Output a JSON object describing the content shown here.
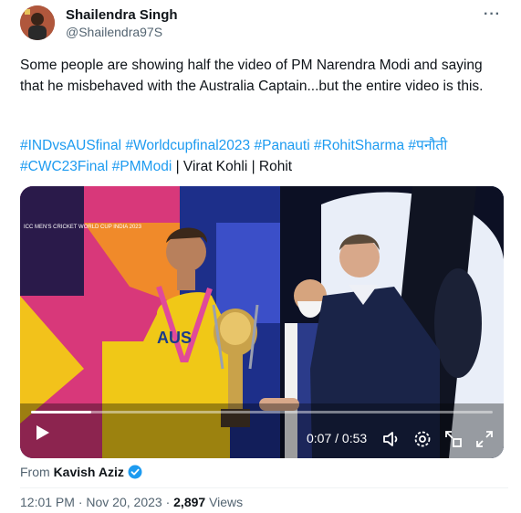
{
  "author": {
    "name": "Shailendra Singh",
    "handle": "@Shailendra97S"
  },
  "post": {
    "text": "Some people are showing half the video of PM Narendra Modi and saying that he misbehaved with the Australia Captain...but the entire video is this.",
    "hashtags": [
      "#INDvsAUSfinal",
      "#Worldcupfinal2023",
      "#Panauti",
      "#RohitSharma",
      "#पनौती",
      "#CWC23Final",
      "#PMModi"
    ],
    "trailing": "| Virat Kohli | Rohit"
  },
  "video": {
    "time_display": "0:07 / 0:53",
    "progress": 0.13,
    "jersey_text": "AUS",
    "logo_text": "ICC MEN'S CRICKET WORLD CUP INDIA 2023"
  },
  "attribution": {
    "from_label": "From",
    "from_name": "Kavish Aziz"
  },
  "meta": {
    "time": "12:01 PM",
    "sep": "·",
    "date": "Nov 20, 2023",
    "views_count": "2,897",
    "views_label": "Views"
  },
  "colors": {
    "link": "#1d9bf0",
    "verified": "#1d9bf0",
    "muted": "#536471"
  },
  "icons": [
    "more-icon",
    "play-icon",
    "volume-icon",
    "settings-icon",
    "pip-icon",
    "fullscreen-icon",
    "verified-icon"
  ]
}
